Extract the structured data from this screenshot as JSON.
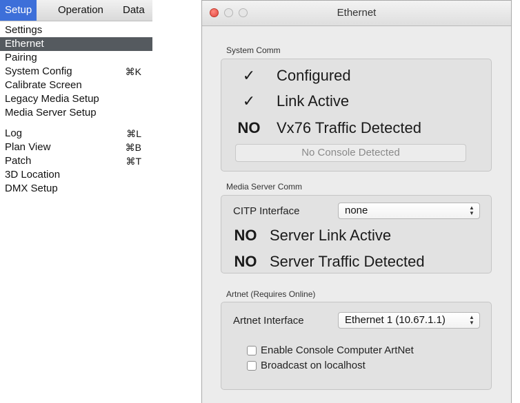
{
  "menu": {
    "bar": [
      "Setup",
      "Operation",
      "Data"
    ],
    "items": [
      {
        "label": "Settings",
        "shortcut": ""
      },
      {
        "label": "Ethernet",
        "shortcut": ""
      },
      {
        "label": "Pairing",
        "shortcut": ""
      },
      {
        "label": "System Config",
        "shortcut": "⌘K"
      },
      {
        "label": "Calibrate Screen",
        "shortcut": ""
      },
      {
        "label": "Legacy Media Setup",
        "shortcut": ""
      },
      {
        "label": "Media Server Setup",
        "shortcut": ""
      },
      {
        "label": "Log",
        "shortcut": "⌘L"
      },
      {
        "label": "Plan View",
        "shortcut": "⌘B"
      },
      {
        "label": "Patch",
        "shortcut": "⌘T"
      },
      {
        "label": "3D Location",
        "shortcut": ""
      },
      {
        "label": "DMX Setup",
        "shortcut": ""
      }
    ]
  },
  "window": {
    "title": "Ethernet",
    "system_comm": {
      "label": "System Comm",
      "rows": [
        {
          "mark": "✓",
          "text": "Configured"
        },
        {
          "mark": "✓",
          "text": "Link Active"
        },
        {
          "mark": "NO",
          "text": "Vx76 Traffic Detected"
        }
      ],
      "button": "No Console Detected"
    },
    "media_server": {
      "label": "Media Server Comm",
      "citp_label": "CITP Interface",
      "citp_value": "none",
      "rows": [
        {
          "mark": "NO",
          "text": "Server Link Active"
        },
        {
          "mark": "NO",
          "text": "Server Traffic Detected"
        }
      ]
    },
    "artnet": {
      "label": "Artnet (Requires Online)",
      "interface_label": "Artnet Interface",
      "interface_value": "Ethernet 1 (10.67.1.1)",
      "checkboxes": [
        {
          "label": "Enable Console Computer ArtNet",
          "checked": false
        },
        {
          "label": "Broadcast on localhost",
          "checked": false
        }
      ]
    }
  },
  "colors": {
    "menu_active": "#3d6fd9",
    "menu_selected": "#555a5f",
    "close_button": "#e0443e"
  }
}
